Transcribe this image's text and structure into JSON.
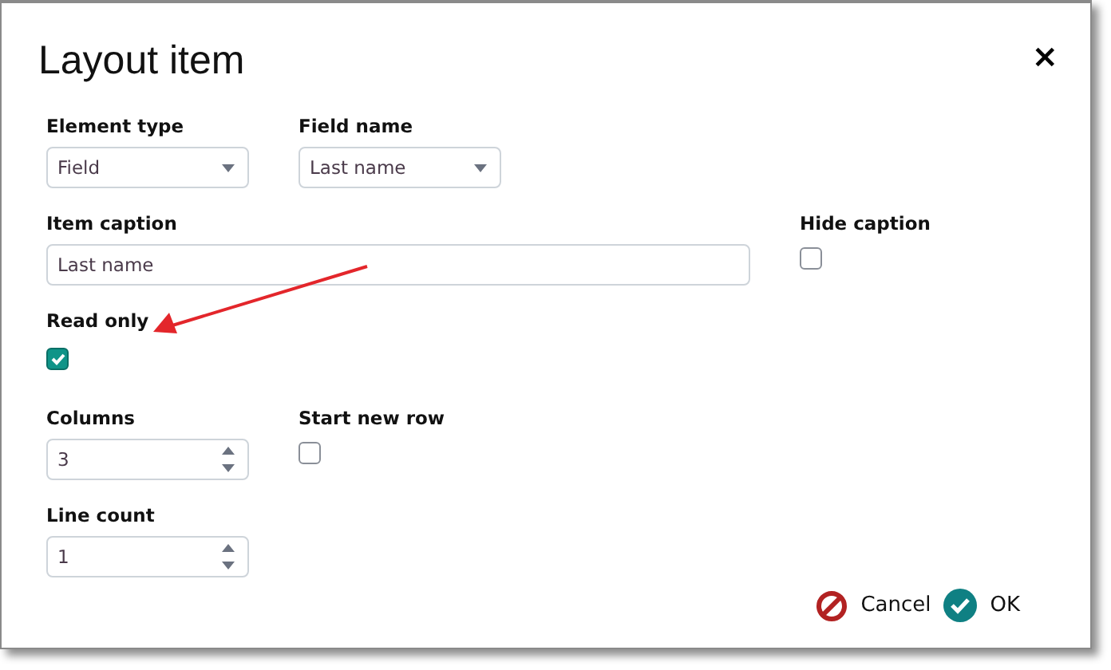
{
  "dialog": {
    "title": "Layout item",
    "close": "×"
  },
  "rows": [
    {
      "fields": [
        {
          "kind": "select",
          "label": "Element type",
          "value": "Field"
        },
        {
          "kind": "select",
          "label": "Field name",
          "value": "Last name"
        }
      ]
    },
    {
      "fields": [
        {
          "kind": "text",
          "label": "Item caption",
          "value": "Last name"
        },
        {
          "kind": "checkbox",
          "label": "Hide caption",
          "checked": false
        }
      ]
    },
    {
      "fields": [
        {
          "kind": "checkbox",
          "label": "Read only",
          "checked": true
        }
      ]
    },
    {
      "fields": [
        {
          "kind": "number",
          "label": "Columns",
          "value": "3"
        },
        {
          "kind": "checkbox",
          "label": "Start new row",
          "checked": false
        }
      ]
    },
    {
      "fields": [
        {
          "kind": "number",
          "label": "Line count",
          "value": "1"
        }
      ]
    }
  ],
  "buttons": [
    {
      "kind": "cancel",
      "label": "Cancel"
    },
    {
      "kind": "ok",
      "label": "OK"
    }
  ]
}
